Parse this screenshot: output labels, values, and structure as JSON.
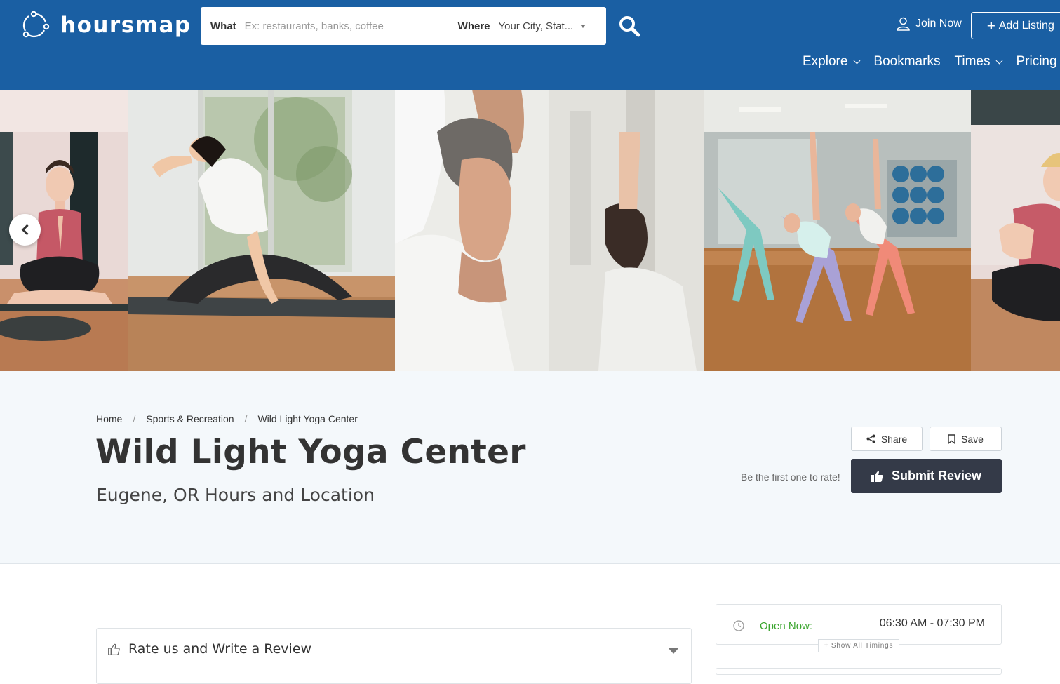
{
  "header": {
    "logo_text": "hoursmap",
    "search": {
      "what_label": "What",
      "what_placeholder": "Ex: restaurants, banks, coffee",
      "where_label": "Where",
      "where_value": "Your City, Stat..."
    },
    "join_label": "Join Now",
    "add_listing_label": "Add Listing",
    "nav": [
      "Explore",
      "Bookmarks",
      "Times",
      "Pricing"
    ],
    "bg_color": "#1a5fa3"
  },
  "breadcrumb": [
    "Home",
    "Sports & Recreation",
    "Wild Light Yoga Center"
  ],
  "listing": {
    "title": "Wild Light Yoga Center",
    "subtitle": "Eugene, OR Hours and Location"
  },
  "actions": {
    "share_label": "Share",
    "save_label": "Save",
    "rate_prompt": "Be the first one to rate!",
    "submit_label": "Submit Review"
  },
  "review_section": {
    "heading": "Rate us and Write a Review"
  },
  "hours": {
    "status_label": "Open Now:",
    "time_range": "06:30 AM - 07:30 PM",
    "show_all_label": "+ Show All Timings",
    "status_color": "#3aa52d"
  },
  "icons": [
    "logo-icon",
    "search-icon",
    "user-icon",
    "plus-icon",
    "chevron-down-icon",
    "chevron-left-icon",
    "share-icon",
    "bookmark-icon",
    "thumbs-up-icon",
    "clock-icon",
    "caret-down-icon"
  ]
}
